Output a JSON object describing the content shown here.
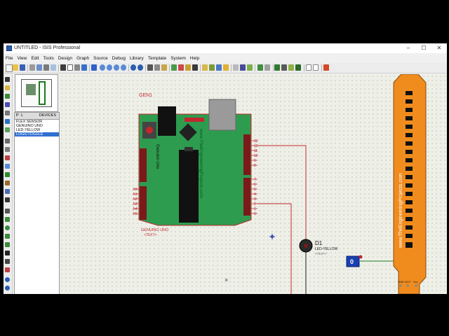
{
  "window": {
    "title": "UNTITLED - ISIS Professional",
    "controls": [
      "–",
      "☐",
      "✕"
    ]
  },
  "menu": [
    "File",
    "View",
    "Edit",
    "Tools",
    "Design",
    "Graph",
    "Source",
    "Debug",
    "Library",
    "Template",
    "System",
    "Help"
  ],
  "devices_panel": {
    "mode_label": "P L",
    "header": "DEVICES",
    "items": [
      "FLEX SENSOR",
      "GENUINO UNO",
      "LED-YELLOW",
      "LOGICTOGGLE"
    ],
    "selected_index": 3
  },
  "canvas": {
    "arduino": {
      "ref": "GEN1",
      "name": "GENUINO UNO",
      "text": "<TEXT>",
      "board_label": "Genuino Uno",
      "watermark": "www.TheEngineeringProjects.com",
      "analog_pins": [
        "A0",
        "A1",
        "A2",
        "A3",
        "A4",
        "A5"
      ],
      "digital_pins": [
        "13",
        "12",
        "11",
        "10",
        "9",
        "8",
        "7",
        "6",
        "5",
        "4",
        "3",
        "2",
        "1",
        "0"
      ]
    },
    "led": {
      "ref": "D1",
      "name": "LED-YELLOW",
      "text": "<TEXT>"
    },
    "logic_toggle": {
      "value": "0"
    },
    "flex_sensor": {
      "watermark": "www.TheEngineeringProjects.com",
      "pins": [
        "GND",
        "OUT",
        "Vcc"
      ]
    }
  },
  "colors": {
    "board_green": "#2e9c4f",
    "wire_red": "#c0282d",
    "flex_orange": "#f08c1e",
    "toggle_blue": "#1a3fb0",
    "selection_blue": "#2f6fd0"
  }
}
